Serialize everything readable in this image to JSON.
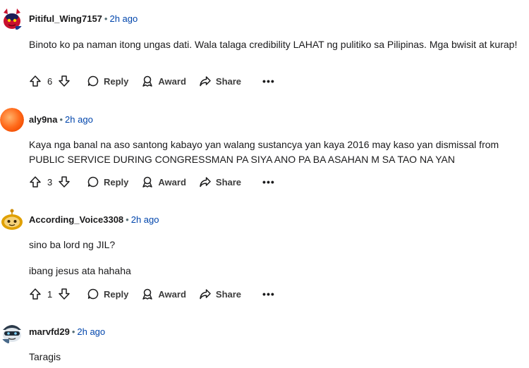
{
  "comments": [
    {
      "username": "Pitiful_Wing7157",
      "time": "2h ago",
      "paragraphs": [
        "Binoto ko pa naman itong ungas dati. Wala talaga credibility LAHAT ng pulitiko sa Pilipinas. Mga bwisit at kurap!"
      ],
      "votes": "6",
      "avatar_icon": "snoo-red-devil-avatar"
    },
    {
      "username": "aly9na",
      "time": "2h ago",
      "paragraphs": [
        "Kaya nga banal na aso santong kabayo yan walang sustancya yan kaya 2016 may kaso yan dismissal from PUBLIC SERVICE DURING CONGRESSMAN PA SIYA ANO PA BA ASAHAN M SA TAO NA YAN"
      ],
      "votes": "3",
      "avatar_icon": "orange-orb-avatar"
    },
    {
      "username": "According_Voice3308",
      "time": "2h ago",
      "paragraphs": [
        "sino ba lord ng JIL?",
        "ibang jesus ata hahaha"
      ],
      "votes": "1",
      "avatar_icon": "snoo-default-avatar"
    },
    {
      "username": "marvfd29",
      "time": "2h ago",
      "paragraphs": [
        "Taragis"
      ],
      "avatar_icon": "snoo-helmet-avatar"
    }
  ],
  "actions": {
    "reply": "Reply",
    "award": "Award",
    "share": "Share",
    "more": "•••"
  },
  "separator": "•",
  "colors": {
    "time_link": "#0045ac",
    "meta_text": "#576f76",
    "text": "#1a1a1b"
  }
}
